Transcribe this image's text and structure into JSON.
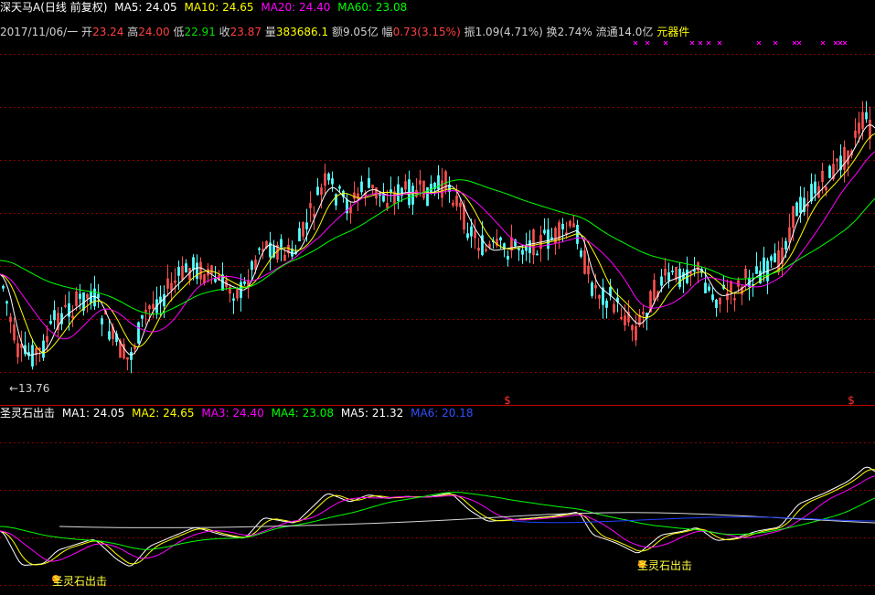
{
  "main_legend": {
    "title": "深天马A(日线 前复权)",
    "items": [
      {
        "label": "MA5: 24.05",
        "color": "#ffffff"
      },
      {
        "label": "MA10: 24.65",
        "color": "#ffff00"
      },
      {
        "label": "MA20: 24.40",
        "color": "#ff00ff"
      },
      {
        "label": "MA60: 23.08",
        "color": "#00ff00"
      }
    ]
  },
  "info_row": {
    "date": "2017/11/06/一",
    "open_label": "开",
    "open": "23.24",
    "high_label": "高",
    "high": "24.00",
    "low_label": "低",
    "low": "22.91",
    "close_label": "收",
    "close": "23.87",
    "volume_label": "量",
    "volume": "383686.1",
    "amount_label": "额",
    "amount": "9.05亿",
    "change_label": "幅",
    "change": "0.73(3.15%)",
    "amplitude_label": "振",
    "amplitude": "1.09(4.71%)",
    "turnover_label": "换",
    "turnover": "2.74%",
    "float_label": "流通",
    "float": "14.0亿",
    "sector": "元器件"
  },
  "price_chart": {
    "min_label": "←13.76",
    "signal_markers": [
      "$",
      "$"
    ]
  },
  "sub_legend": {
    "title": "圣灵石出击",
    "items": [
      {
        "label": "MA1: 24.05",
        "color": "#ffffff"
      },
      {
        "label": "MA2: 24.65",
        "color": "#ffff00"
      },
      {
        "label": "MA3: 24.40",
        "color": "#ff00ff"
      },
      {
        "label": "MA4: 23.08",
        "color": "#00ff00"
      },
      {
        "label": "MA5: 21.32",
        "color": "#ffffff"
      },
      {
        "label": "MA6: 20.18",
        "color": "#0000ff"
      }
    ]
  },
  "sub_chart": {
    "signal_labels": [
      "圣灵石出击",
      "圣灵石出击"
    ]
  },
  "colors": {
    "up": "#ff5050",
    "down": "#54ffff",
    "grid": "#8b0000",
    "separator": "#c00000",
    "ma5": "#ffffff",
    "ma10": "#ffff00",
    "ma20": "#ff00ff",
    "ma60": "#00ff00",
    "ma_slow": "#d8d8d8",
    "ma6": "#0000ff"
  }
}
